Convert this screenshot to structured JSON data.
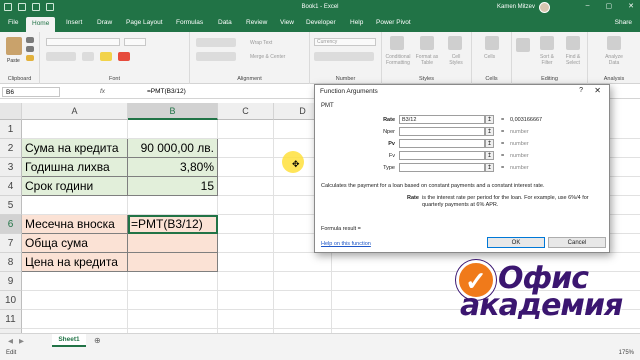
{
  "titlebar": {
    "title": "Book1 - Excel",
    "user": "Kamen Mitzev",
    "minimize": "–",
    "restore": "▢",
    "close": "✕"
  },
  "tabs": [
    "File",
    "Home",
    "Insert",
    "Draw",
    "Page Layout",
    "Formulas",
    "Data",
    "Review",
    "View",
    "Developer",
    "Help",
    "Power Pivot"
  ],
  "active_tab": "Home",
  "share_label": "Share",
  "ribbon": {
    "groups": [
      "Clipboard",
      "Font",
      "Alignment",
      "Number",
      "Styles",
      "Cells",
      "Editing",
      "Analysis"
    ],
    "paste_label": "Paste",
    "wrap_text": "Wrap Text",
    "merge_center": "Merge & Center",
    "number_format": "Currency",
    "conditional_formatting": "Conditional Formatting",
    "format_as_table": "Format as Table",
    "cell_styles": "Cell Styles",
    "cells_label": "Cells",
    "sort_filter": "Sort & Filter",
    "find_select": "Find & Select",
    "analyze_data": "Analyze Data"
  },
  "formula_bar": {
    "name_box": "B6",
    "fx": "fx",
    "content": "=PMT(B3/12)"
  },
  "grid": {
    "columns": [
      "A",
      "B",
      "C",
      "D"
    ],
    "rows": [
      "1",
      "2",
      "3",
      "4",
      "5",
      "6",
      "7",
      "8",
      "9",
      "10",
      "11",
      "12",
      "13"
    ],
    "cells": {
      "A2": "Сума на кредита",
      "B2": "90 000,00 лв.",
      "A3": "Годишна лихва",
      "B3": "3,80%",
      "A4": "Срок години",
      "B4": "15",
      "A6": "Месечна вноска",
      "B6": "=PMT(B3/12)",
      "A7": "Обща сума",
      "A8": "Цена на кредита"
    }
  },
  "sheet_tab": "Sheet1",
  "status": {
    "mode": "Edit",
    "zoom": "175%"
  },
  "dialog": {
    "title": "Function Arguments",
    "help_icon": "?",
    "close_icon": "✕",
    "function_name": "PMT",
    "args": [
      {
        "label": "Rate",
        "value": "B3/12",
        "result": "0,003166667"
      },
      {
        "label": "Nper",
        "value": "",
        "result": "number"
      },
      {
        "label": "Pv",
        "value": "",
        "result": "number"
      },
      {
        "label": "Fv",
        "value": "",
        "result": "number"
      },
      {
        "label": "Type",
        "value": "",
        "result": "number"
      }
    ],
    "equals": "=",
    "collapse_icon": "↥",
    "description": "Calculates the payment for a loan based on constant payments and a constant interest rate.",
    "param_name": "Rate",
    "param_description": "is the interest rate per period for the loan. For example, use 6%/4 for quarterly payments at 6% APR.",
    "formula_result": "Formula result =",
    "help_link": "Help on this function",
    "ok": "OK",
    "cancel": "Cancel"
  },
  "logo": {
    "line1": "Офис",
    "line2": "академия"
  }
}
